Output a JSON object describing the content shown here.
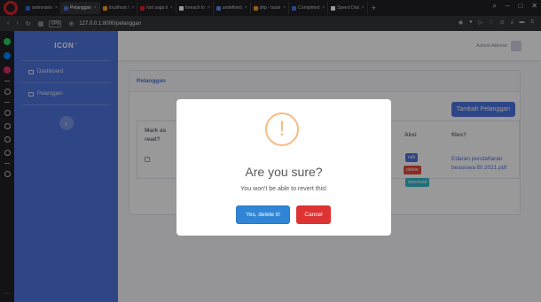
{
  "browser": {
    "tabs": [
      {
        "label": "animeoino",
        "active": false,
        "color": "#2a6be0"
      },
      {
        "label": "Pelanggan",
        "active": true,
        "color": "#4e73df"
      },
      {
        "label": "localhost /",
        "active": false,
        "color": "#f4a21a"
      },
      {
        "label": "lost saga li",
        "active": false,
        "color": "#e0202a"
      },
      {
        "label": "foreach lo",
        "active": false,
        "color": "#ffffff"
      },
      {
        "label": "undefined",
        "active": false,
        "color": "#5a8dee"
      },
      {
        "label": "php - base",
        "active": false,
        "color": "#f4a21a"
      },
      {
        "label": "Completed",
        "active": false,
        "color": "#4e73df"
      },
      {
        "label": "Speed Dial",
        "active": false,
        "color": "#ffffff"
      }
    ],
    "new_tab": "+",
    "url": "127.0.0.1:8000/pelanggan",
    "vpn": "VPN"
  },
  "rail_colors": [
    "#25d366",
    "#0084ff",
    "#e1306c"
  ],
  "sidebar": {
    "brand": "ICON",
    "items": [
      {
        "label": "Dashboard"
      },
      {
        "label": "Pelanggan"
      }
    ],
    "toggle": "‹"
  },
  "topbar": {
    "user": "Admin Akhoist"
  },
  "card": {
    "title": "Pelanggan",
    "add_button": "Tambah Pelanggan",
    "columns": [
      "Mark as read?",
      "Aksi",
      "files?"
    ],
    "row": {
      "actions": [
        {
          "label": "edit",
          "color": "#4e73df"
        },
        {
          "label": "delete",
          "color": "#e74a3b"
        },
        {
          "label": "download",
          "color": "#36b9cc"
        }
      ],
      "file": "Edaran pendaftaran beasiswa BI 2021.pdf"
    }
  },
  "modal": {
    "icon": "!",
    "title": "Are you sure?",
    "text": "You won't be able to revert this!",
    "confirm": "Yes, delete it!",
    "cancel": "Cancel"
  }
}
